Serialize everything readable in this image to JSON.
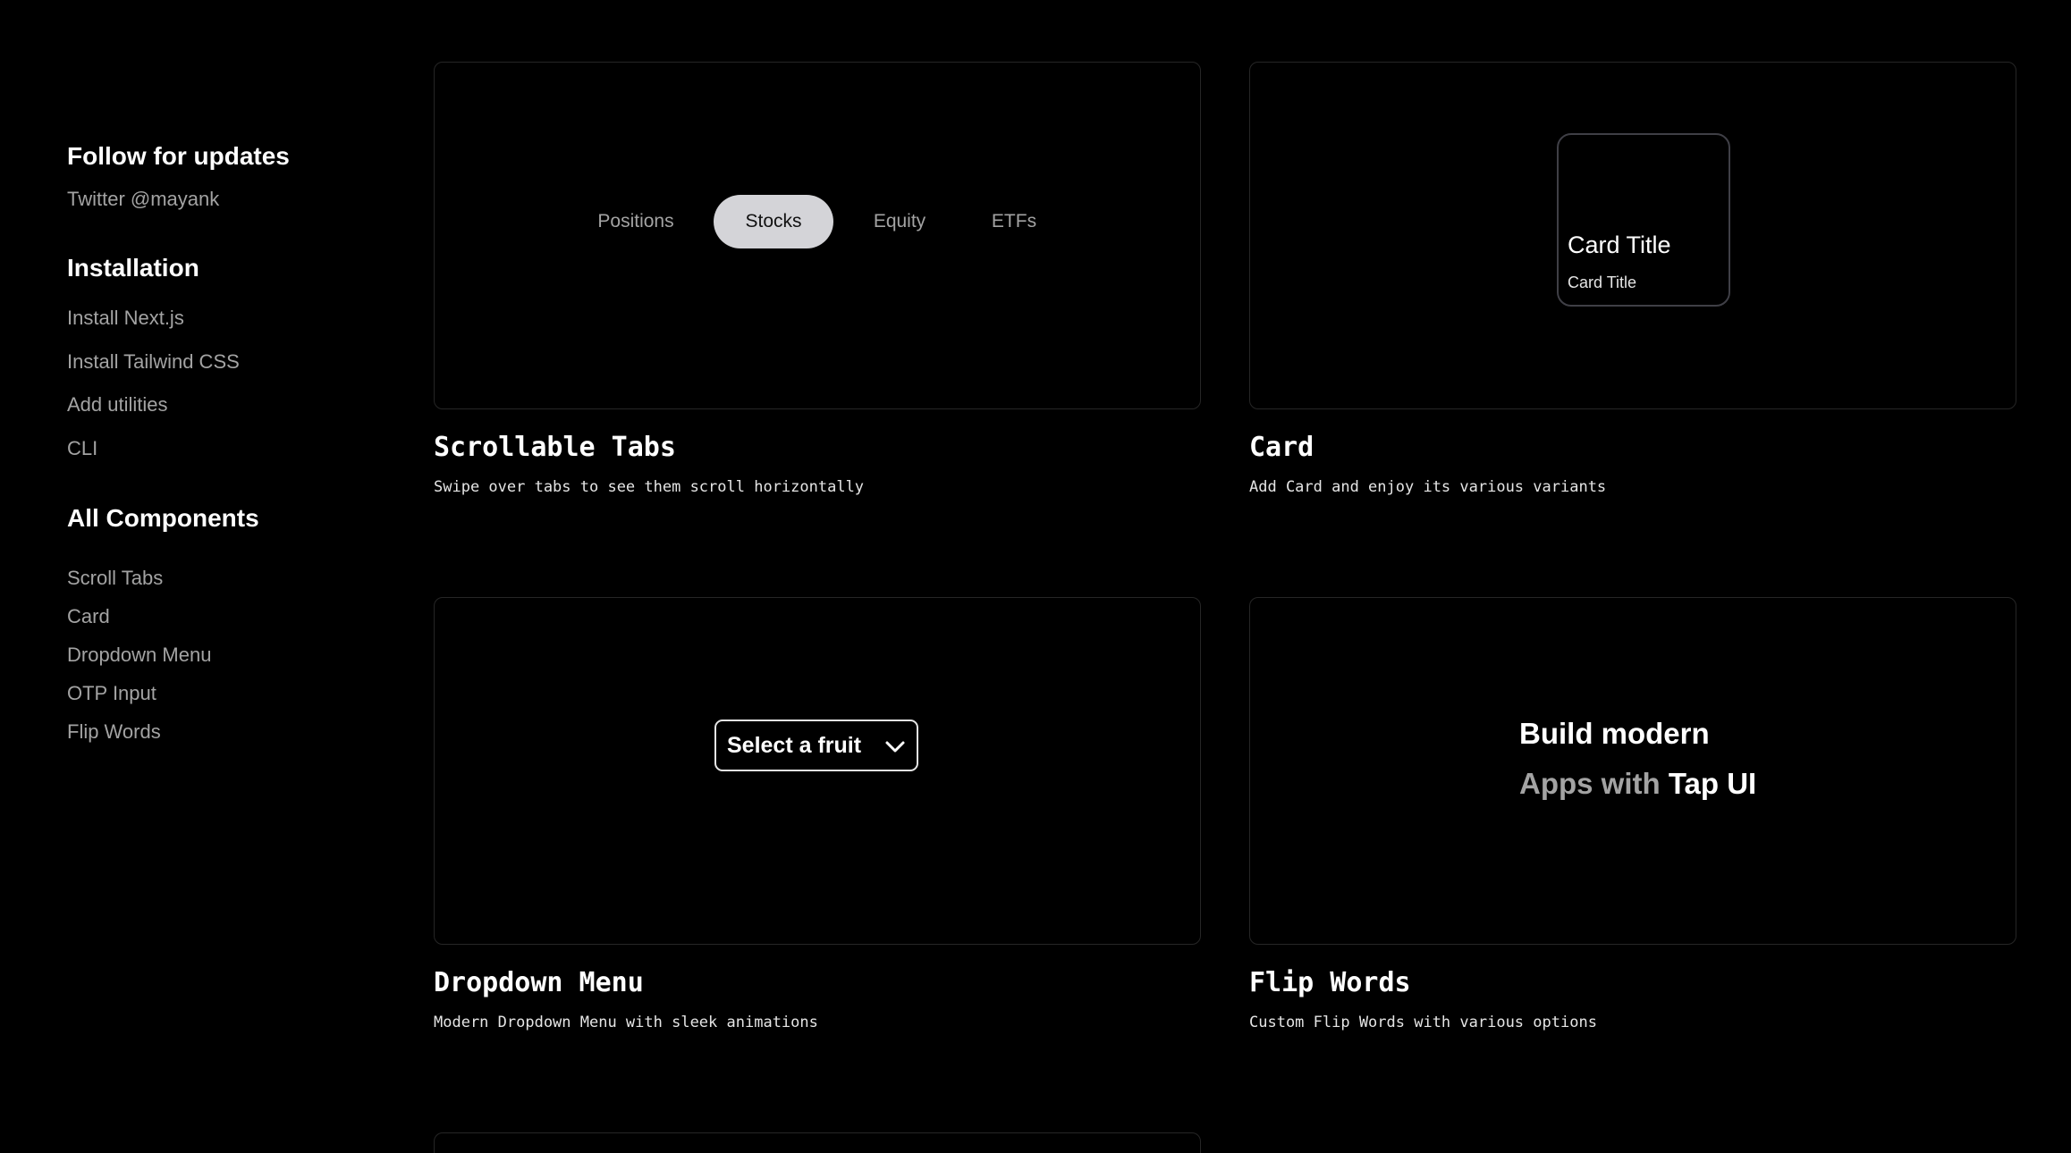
{
  "sidebar": {
    "follow": {
      "heading": "Follow for updates",
      "link": "Twitter @mayank"
    },
    "installation": {
      "heading": "Installation",
      "items": [
        "Install Next.js",
        "Install Tailwind CSS",
        "Add utilities",
        "CLI"
      ]
    },
    "components": {
      "heading": "All Components",
      "items": [
        "Scroll Tabs",
        "Card",
        "Dropdown Menu",
        "OTP Input",
        "Flip Words"
      ]
    }
  },
  "cards": {
    "scroll_tabs": {
      "title": "Scrollable Tabs",
      "description": "Swipe over tabs to see them scroll horizontally",
      "tabs": [
        "Positions",
        "Stocks",
        "Equity",
        "ETFs"
      ],
      "active_tab": "Stocks"
    },
    "card": {
      "title": "Card",
      "description": "Add Card and enjoy its various variants",
      "demo_title": "Card Title",
      "demo_subtitle": "Card Title"
    },
    "dropdown": {
      "title": "Dropdown Menu",
      "description": "Modern Dropdown Menu with sleek animations",
      "selected": "Select a fruit",
      "icon": "chevron-down-icon"
    },
    "flip_words": {
      "title": "Flip Words",
      "description": "Custom Flip Words with various options",
      "line1": "Build modern",
      "line2_dim": "Apps with",
      "line2_bright": "Tap UI"
    }
  }
}
